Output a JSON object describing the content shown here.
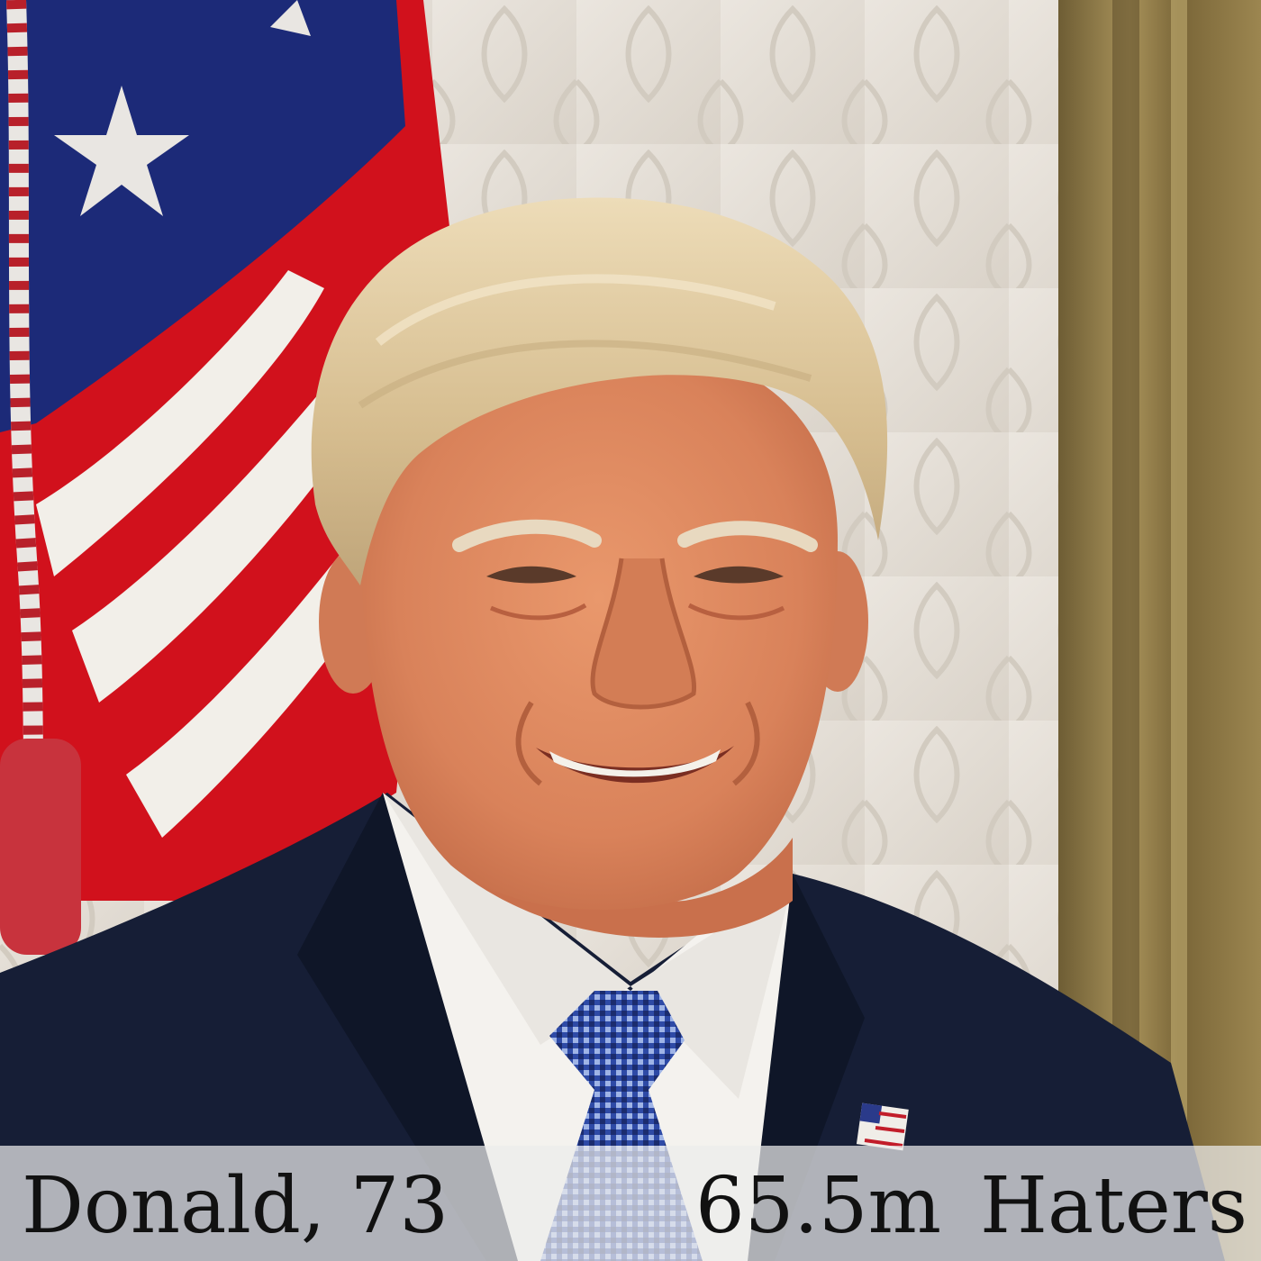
{
  "caption": {
    "name_age": "Donald, 73",
    "count": "65.5m",
    "label": "Haters"
  },
  "colors": {
    "flag_blue": "#1c2a78",
    "flag_red": "#d1111c",
    "flag_white": "#f2efe9",
    "wall": "#e4ded6",
    "frame_gold": "#8a7645",
    "suit": "#161e36",
    "shirt": "#f4f2ee",
    "tie": "#3a58b8",
    "hair": "#dcc49a",
    "skin": "#e08a62",
    "caption_bar": "#ececec",
    "caption_text": "#111111"
  }
}
